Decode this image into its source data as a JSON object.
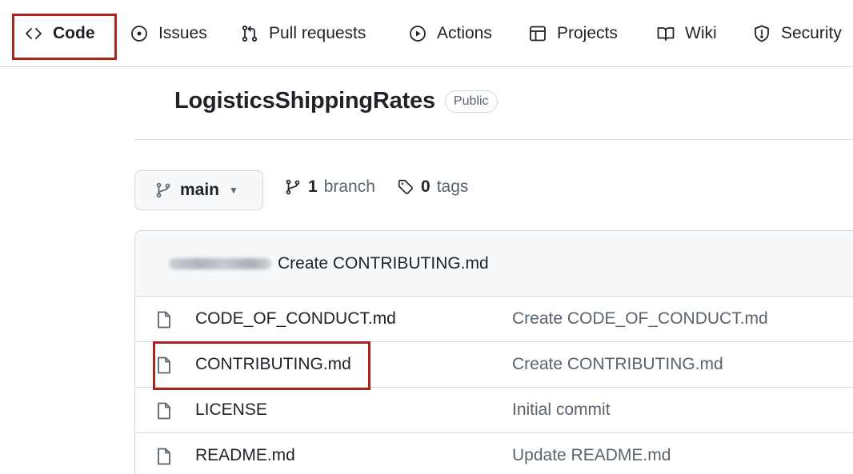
{
  "nav": {
    "code": "Code",
    "issues": "Issues",
    "pulls": "Pull requests",
    "actions": "Actions",
    "projects": "Projects",
    "wiki": "Wiki",
    "security": "Security"
  },
  "repo": {
    "name": "LogisticsShippingRates",
    "visibility": "Public"
  },
  "branch": {
    "current": "main",
    "branch_count": "1",
    "branch_label": "branch",
    "tag_count": "0",
    "tag_label": "tags"
  },
  "latest_commit": {
    "message": "Create CONTRIBUTING.md"
  },
  "files": [
    {
      "name": "CODE_OF_CONDUCT.md",
      "commit": "Create CODE_OF_CONDUCT.md",
      "icon": "file-icon"
    },
    {
      "name": "CONTRIBUTING.md",
      "commit": "Create CONTRIBUTING.md",
      "icon": "file-icon"
    },
    {
      "name": "LICENSE",
      "commit": "Initial commit",
      "icon": "file-icon"
    },
    {
      "name": "README.md",
      "commit": "Update README.md",
      "icon": "file-icon"
    }
  ],
  "colors": {
    "highlight": "#a8251d",
    "text": "#1f2328",
    "muted": "#59636e",
    "border": "#d1d9e0"
  }
}
